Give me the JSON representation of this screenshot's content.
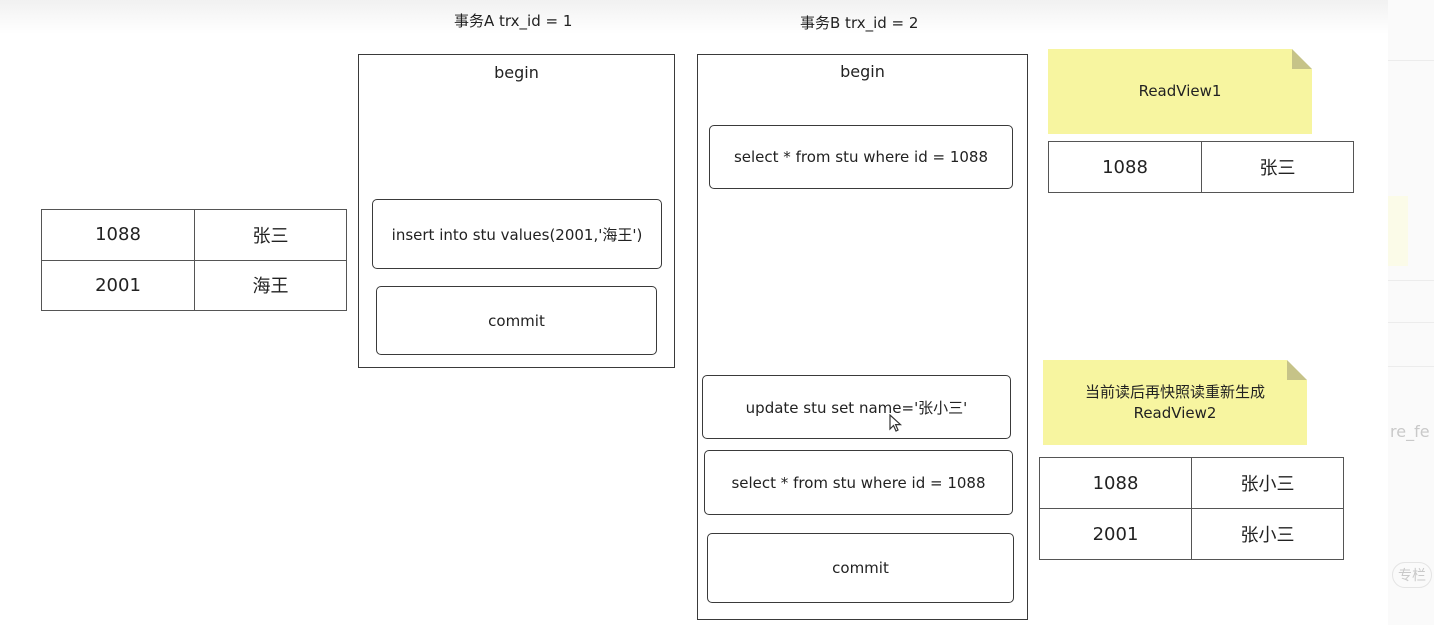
{
  "transactions": {
    "a": {
      "title": "事务A trx_id = 1",
      "begin": "begin",
      "insert": "insert into stu values(2001,'海王')",
      "commit": "commit"
    },
    "b": {
      "title": "事务B trx_id = 2",
      "begin": "begin",
      "select1": "select * from stu where id = 1088",
      "update": "update stu set name='张小三'",
      "select2": "select * from stu where id = 1088",
      "commit": "commit"
    }
  },
  "base_table": {
    "rows": [
      {
        "id": "1088",
        "name": "张三"
      },
      {
        "id": "2001",
        "name": "海王"
      }
    ]
  },
  "readview1": {
    "note": "ReadView1",
    "rows": [
      {
        "id": "1088",
        "name": "张三"
      }
    ]
  },
  "readview2": {
    "note_line1": "当前读后再快照读重新生成",
    "note_line2": "ReadView2",
    "rows": [
      {
        "id": "1088",
        "name": "张小三"
      },
      {
        "id": "2001",
        "name": "张小三"
      }
    ]
  },
  "background": {
    "partial_text": "re_fe",
    "partial_button": "专栏"
  },
  "colors": {
    "note_yellow": "#f7f5a0",
    "border": "#3a3a3a"
  }
}
